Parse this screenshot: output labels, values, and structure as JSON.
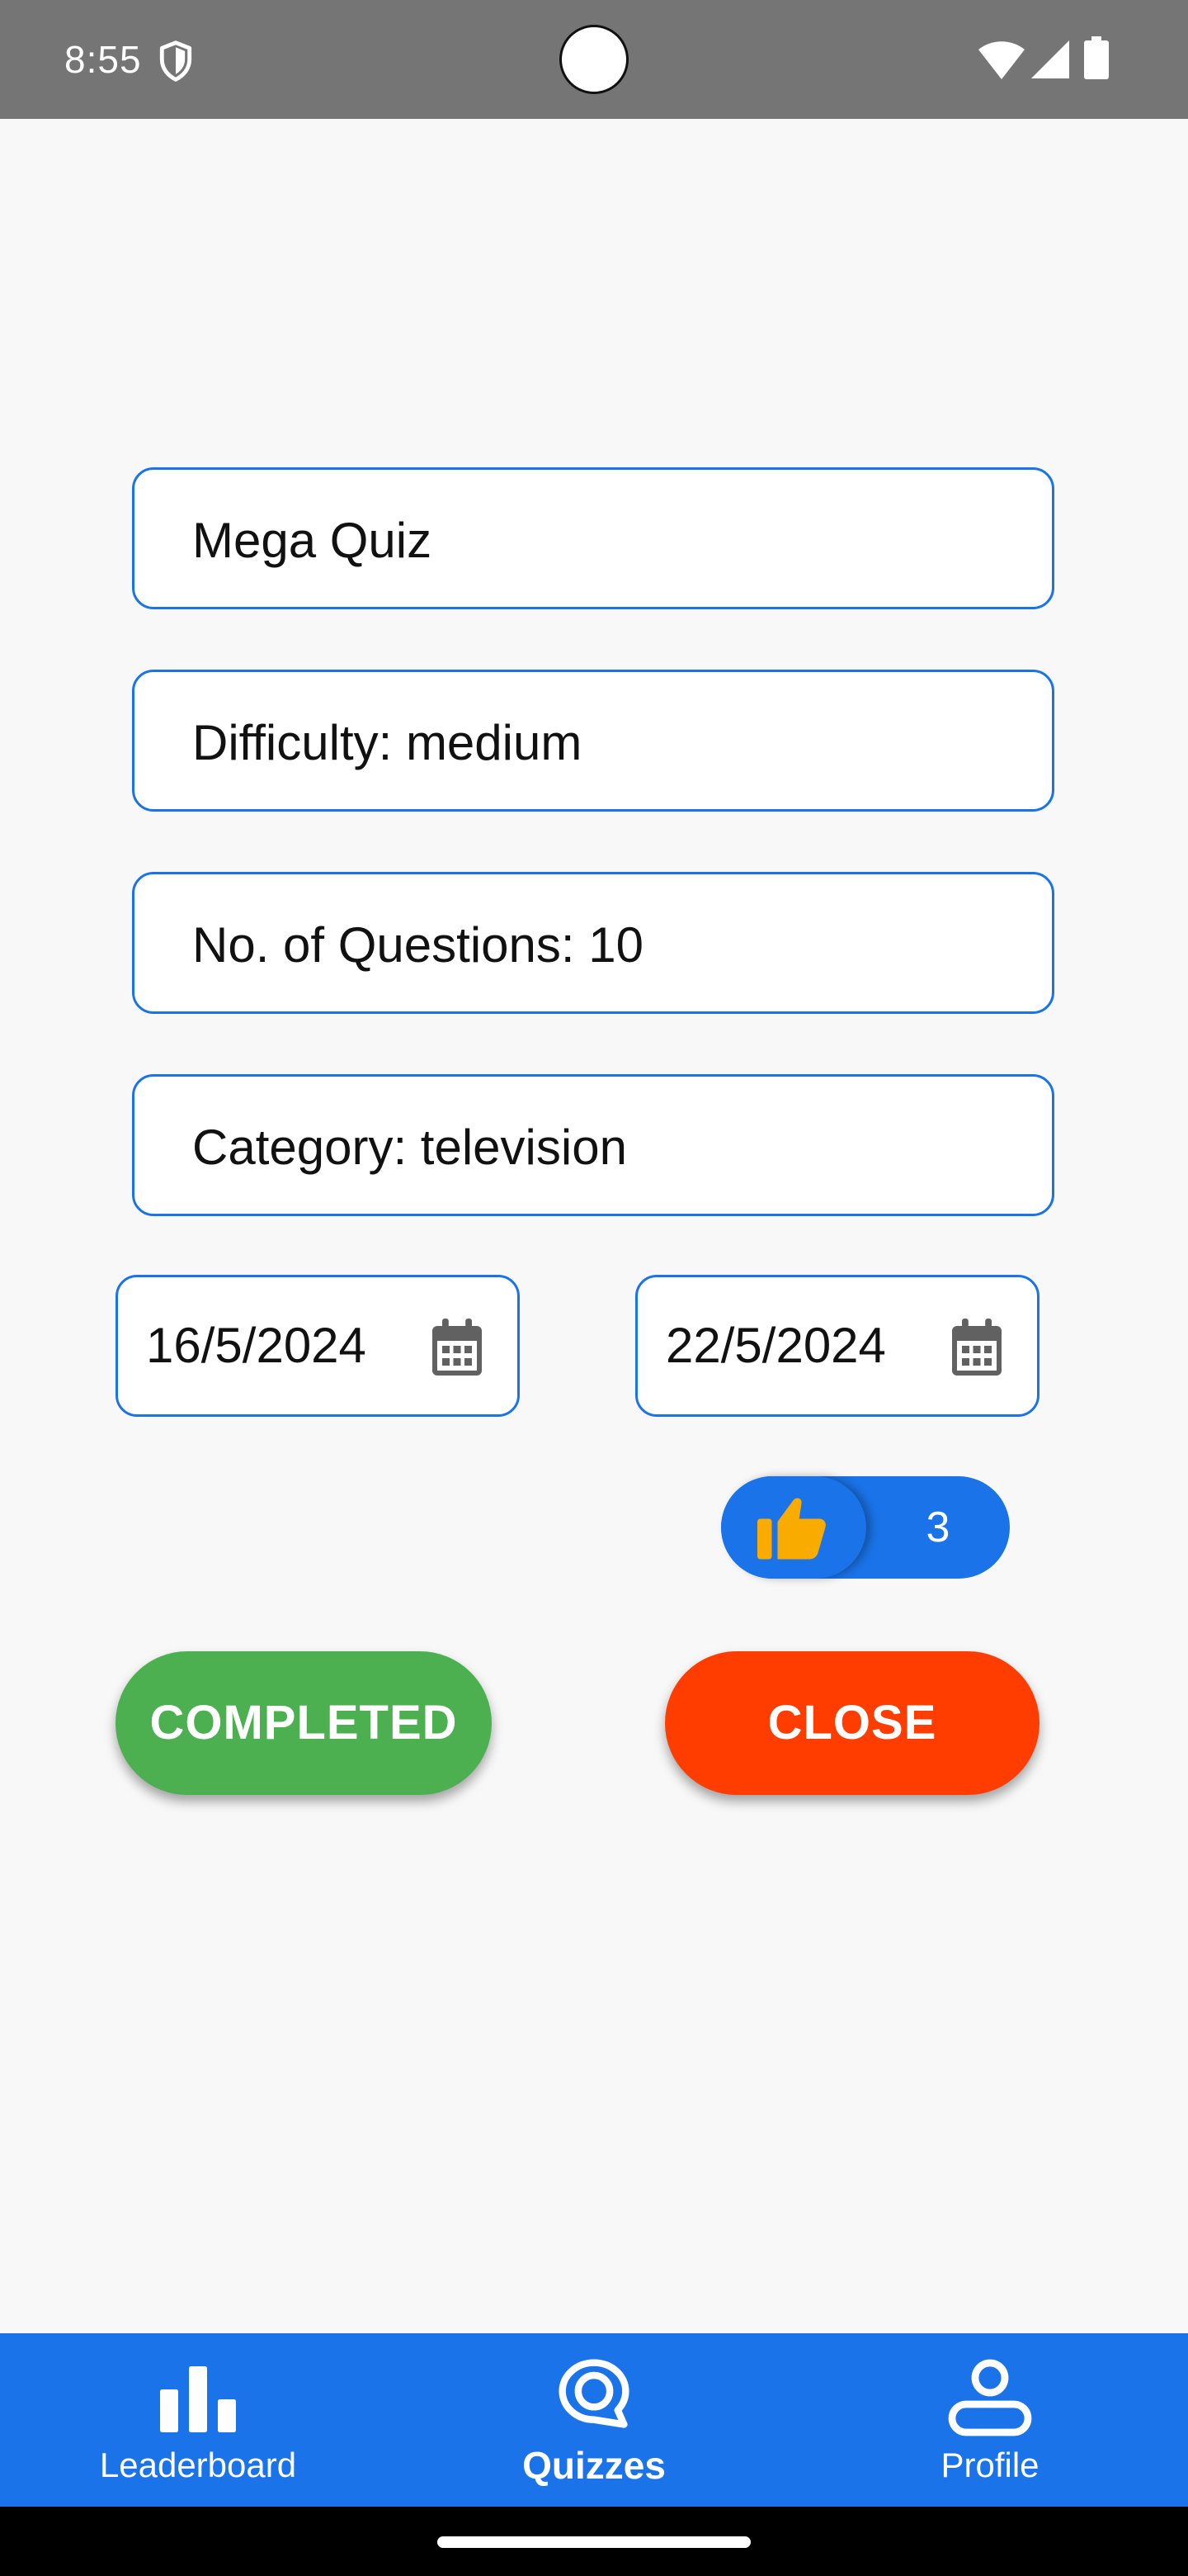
{
  "status_bar": {
    "time": "8:55",
    "icons": [
      "shield-icon",
      "wifi-icon",
      "signal-icon",
      "battery-icon"
    ]
  },
  "form": {
    "title_value": "Mega Quiz",
    "difficulty_value": "Difficulty: medium",
    "questions_value": "No. of Questions: 10",
    "category_value": "Category: television",
    "start_date": "16/5/2024",
    "end_date": "22/5/2024"
  },
  "likes": {
    "icon": "thumbs-up-icon",
    "count": "3"
  },
  "actions": {
    "completed_label": "COMPLETED",
    "close_label": "CLOSE"
  },
  "bottom_nav": {
    "items": [
      {
        "label": "Leaderboard",
        "icon": "bar-chart-icon",
        "active": false
      },
      {
        "label": "Quizzes",
        "icon": "quiz-chat-icon",
        "active": true
      },
      {
        "label": "Profile",
        "icon": "person-icon",
        "active": false
      }
    ]
  },
  "colors": {
    "accent": "#1a73e8",
    "completed": "#4caf50",
    "close": "#ff3d00",
    "like_thumb": "#f9ab00",
    "status_bar": "#757575",
    "background": "#f8f8f8"
  }
}
